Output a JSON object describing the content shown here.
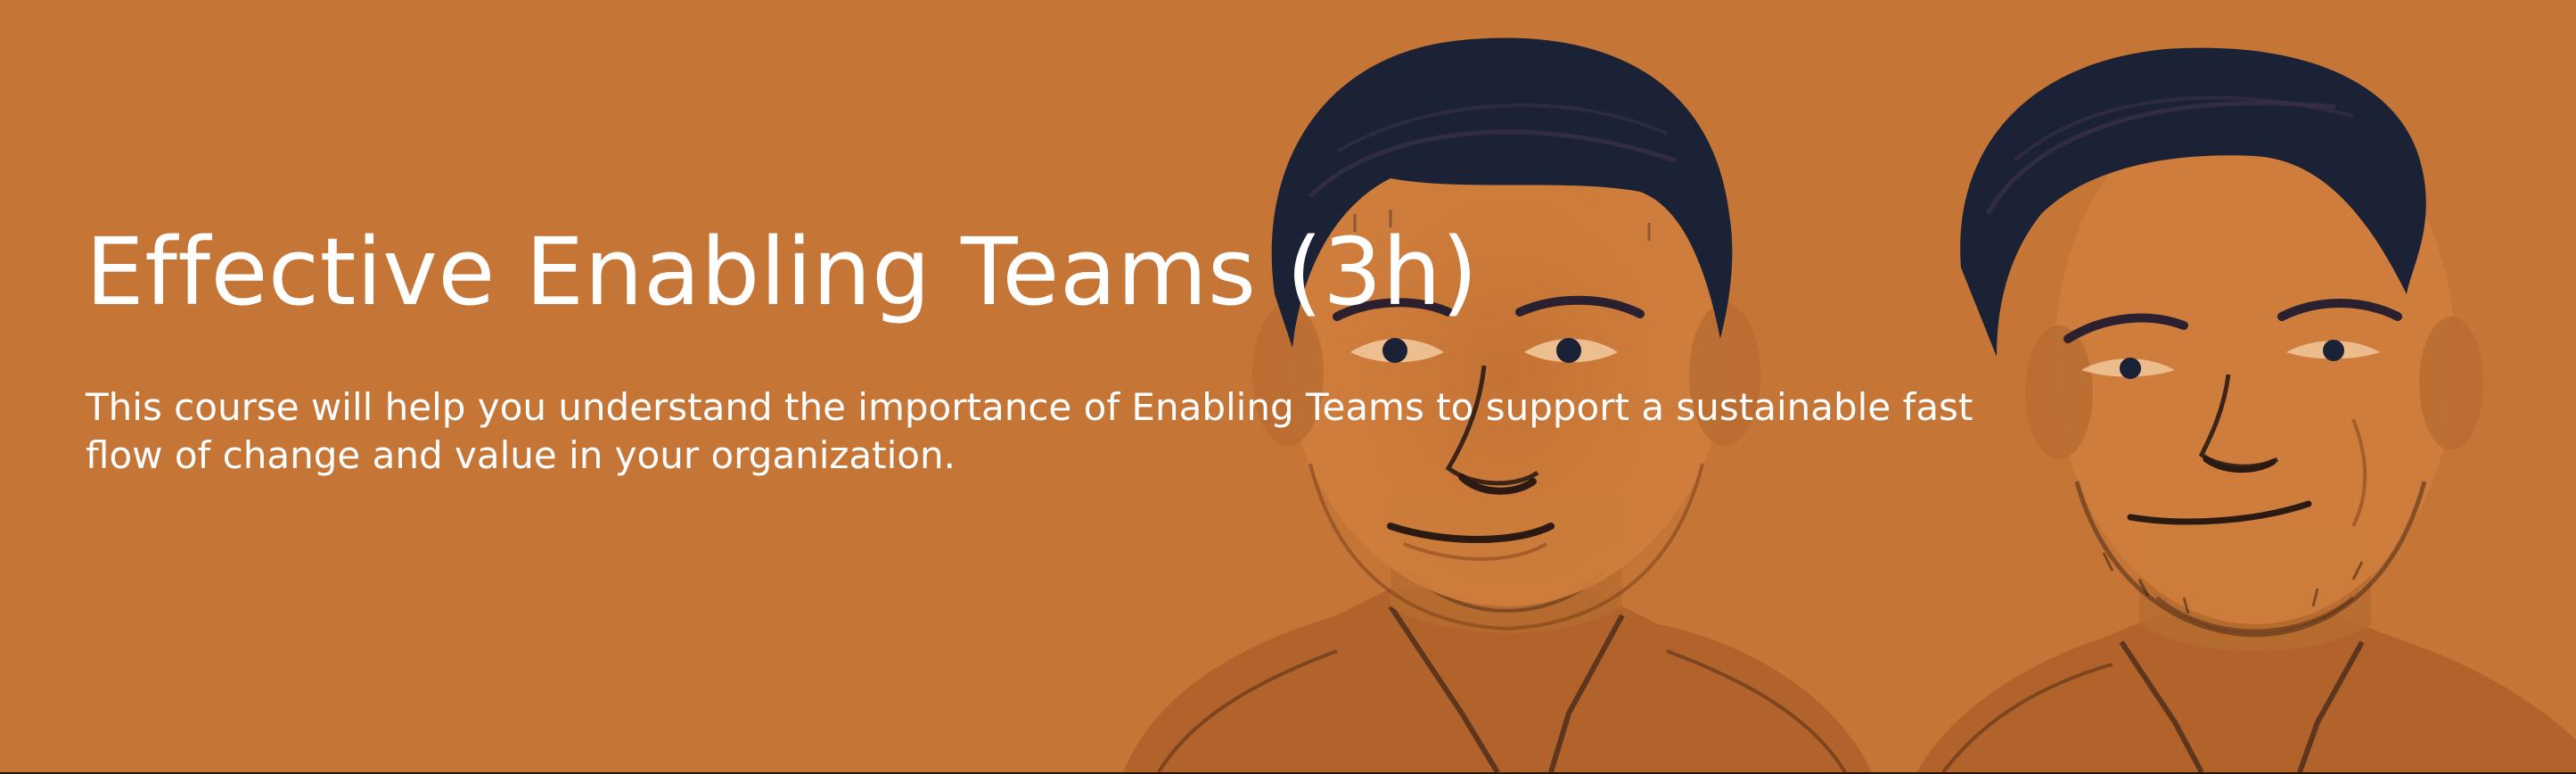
{
  "colors": {
    "background": "#c57536",
    "text": "#ffffff",
    "sketch_dark": "#1c2236",
    "sketch_mid": "#8a4a20"
  },
  "hero": {
    "title": "Effective Enabling Teams (3h)",
    "description": "This course will help you understand the importance of Enabling Teams to support a sustainable fast flow of change and value in your organization."
  },
  "images": {
    "left_portrait": "sketch-portrait-man-smiling",
    "right_portrait": "sketch-portrait-man-smiling"
  }
}
